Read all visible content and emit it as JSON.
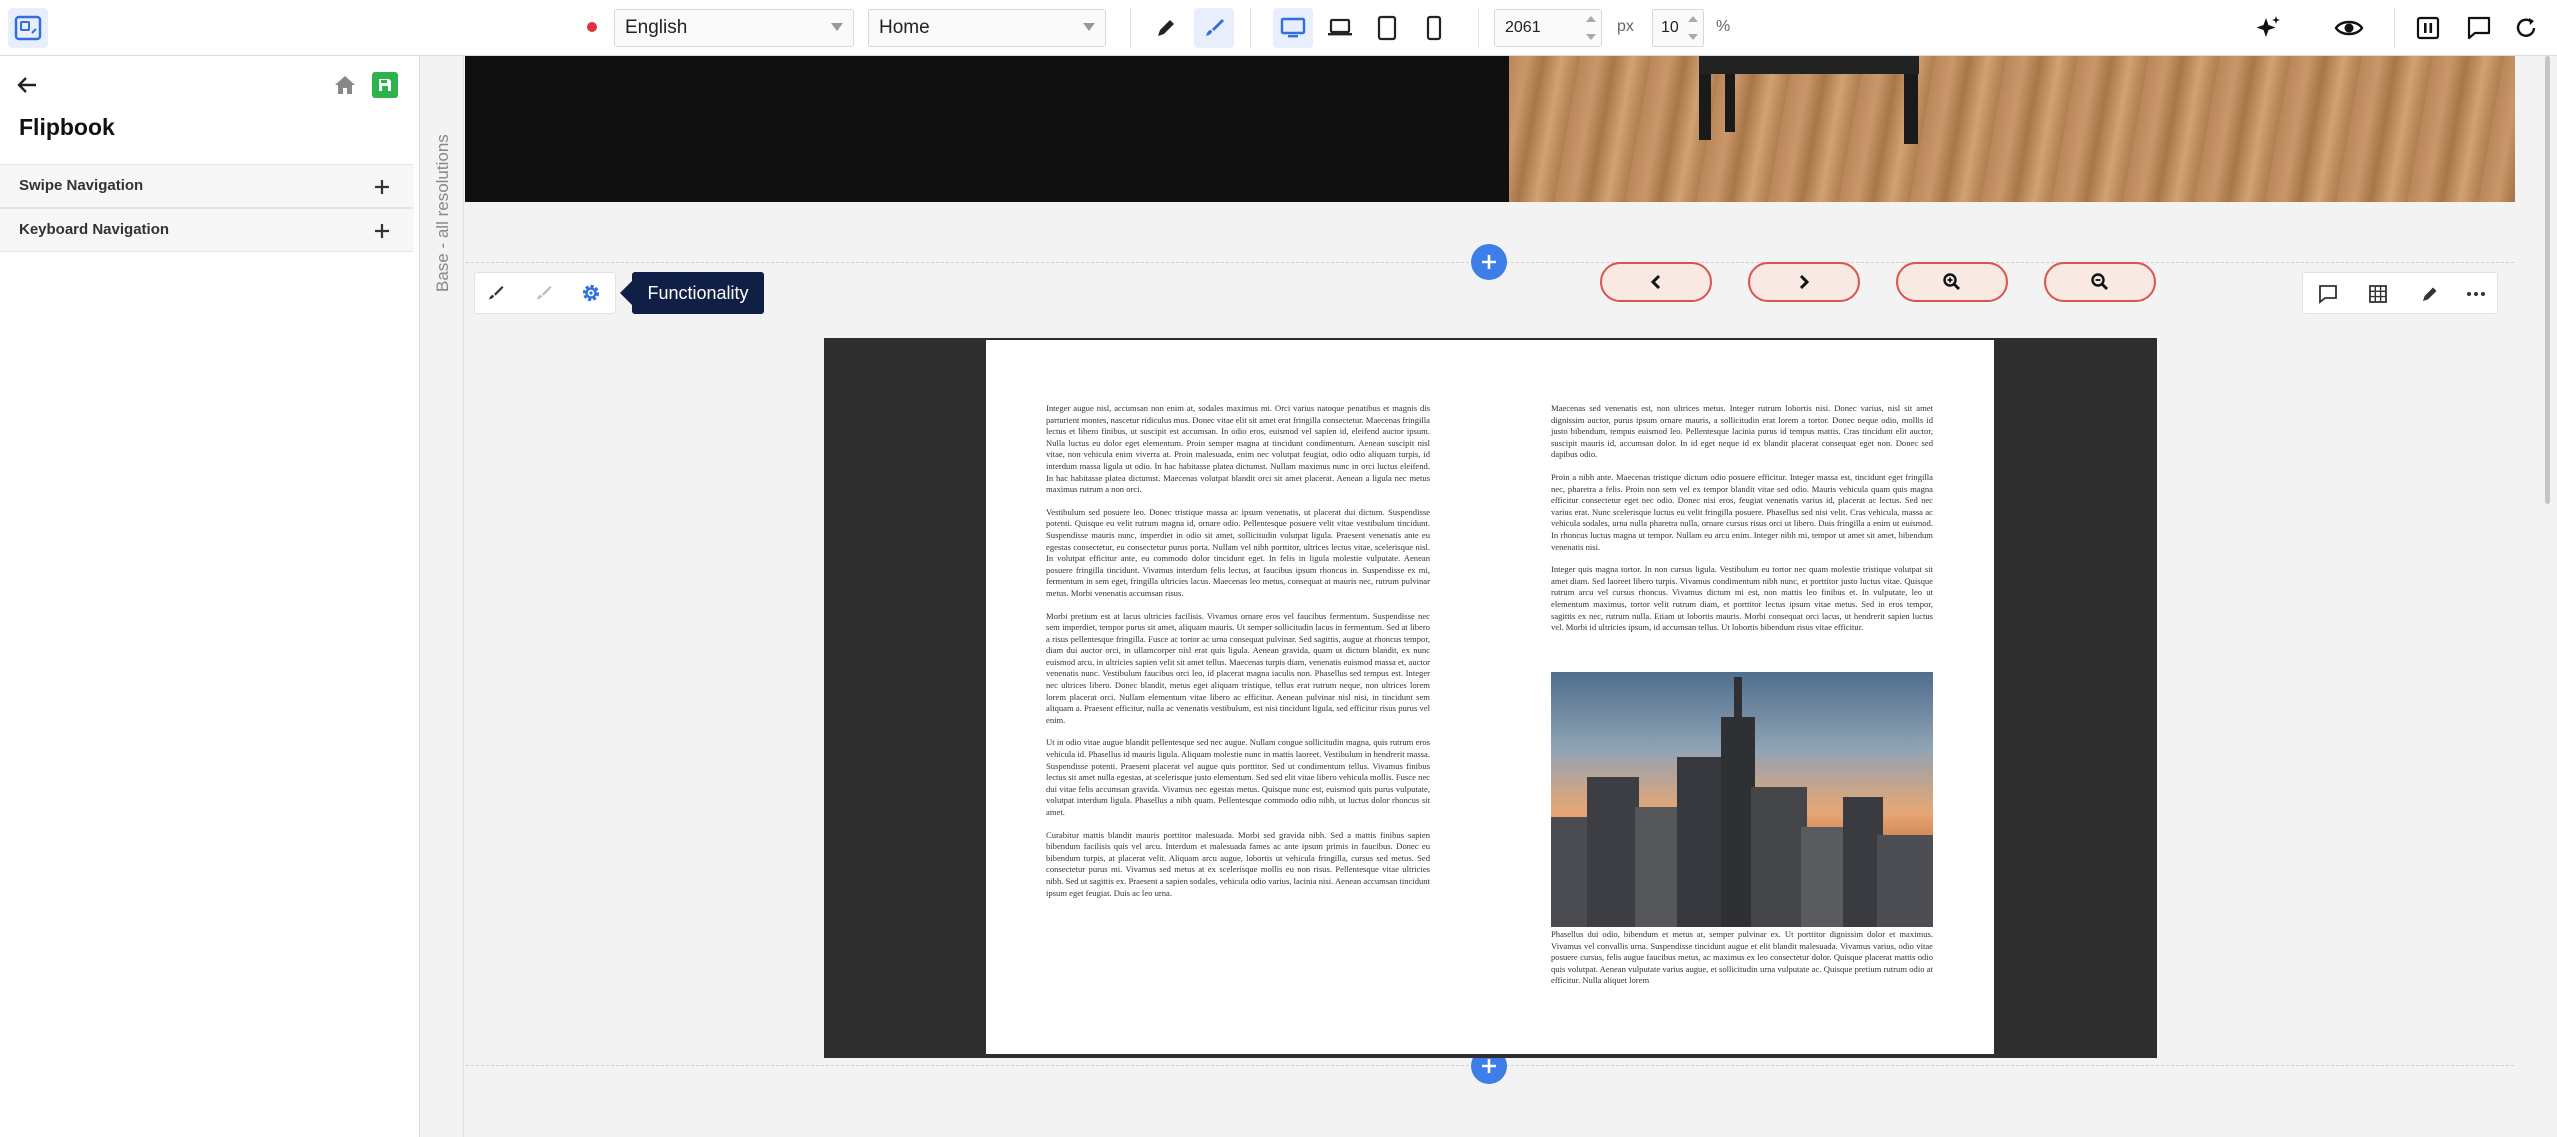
{
  "toolbar": {
    "language": {
      "selected": "English"
    },
    "page": {
      "selected": "Home"
    },
    "width_value": "2061",
    "width_unit": "px",
    "zoom_value": "10",
    "zoom_unit": "%"
  },
  "left_panel": {
    "title": "Flipbook",
    "accordions": [
      {
        "label": "Swipe Navigation"
      },
      {
        "label": "Keyboard Navigation"
      }
    ]
  },
  "vertical_label": "Base - all resolutions",
  "tooltip": "Functionality",
  "colors": {
    "accent": "#3d7ee8",
    "save_green": "#2db34a",
    "tooltip_bg": "#0f1f46",
    "pill_border": "#d9534f",
    "record_dot": "#e0303a"
  },
  "flipbook": {
    "left_page": [
      "Integer augue nisl, accumsan non enim at, sodales maximus mi. Orci varius natoque penatibus et magnis dis parturient montes, nascetur ridiculus mus. Donec vitae elit sit amet erat fringilla consectetur. Maecenas fringilla lectus et libero finibus, ut suscipit est accumsan. In odio eros, euismod vel sapien id, eleifend auctor ipsum. Nulla luctus eu dolor eget elementum. Proin semper magna at tincidunt condimentum. Aenean suscipit nisl vitae, non vehicula enim viverra at. Proin malesuada, enim nec volutpat feugiat, odio odio aliquam turpis, id interdum massa ligula ut odio. In hac habitasse platea dictumst. Nullam maximus nunc in orci luctus eleifend. In hac habitasse platea dictumst. Maecenas volutpat blandit orci sit amet placerat. Aenean a ligula nec metus maximus rutrum a non orci.",
      "Vestibulum sed posuere leo. Donec tristique massa ac ipsum venenatis, ut placerat dui dictum. Suspendisse potenti. Quisque eu velit rutrum magna id, ornare odio. Pellentesque posuere velit vitae vestibulum tincidunt. Suspendisse mauris nunc, imperdiet in odio sit amet, sollicitudin volutpat ligula. Praesent venenatis ante eu egestas consectetur, eu consectetur purus porta. Nullam vel nibh porttitor, ultrices lectus vitae, scelerisque nisl. In volutpat efficitur ante, eu commodo dolor tincidunt eget. In felis in ligula molestie vulputate. Aenean posuere fringilla tincidunt. Vivamus interdum felis lectus, at faucibus ipsum rhoncus in. Suspendisse ex mi, fermentum in sem eget, fringilla ultricies lacus. Maecenas leo metus, consequat at mauris nec, rutrum pulvinar metus. Morbi venenatis accumsan risus.",
      "Morbi pretium est at lacus ultricies facilisis. Vivamus ornare eros vel faucibus fermentum. Suspendisse nec sem imperdiet, tempor purus sit amet, aliquam mauris. Ut semper sollicitudin lacus in fermentum. Sed at libero a risus pellentesque fringilla. Fusce ac tortor ac urna consequat pulvinar. Sed sagittis, augue at rhoncus tempor, diam dui auctor orci, in ullamcorper nisl erat quis ligula. Aenean gravida, quam ut dictum blandit, ex nunc euismod arcu, in ultricies sapien velit sit amet tellus. Maecenas turpis diam, venenatis euismod massa et, auctor venenatis nunc. Vestibulum faucibus orci leo, id placerat magna iaculis non. Phasellus sed tempus est. Integer nec ultrices libero. Donec blandit, metus eget aliquam tristique, tellus erat rutrum neque, non ultrices lorem lorem placerat orci. Nullam elementum vitae libero ac efficitur. Aenean pulvinar nisl nisi, in tincidunt sem aliquam a. Praesent efficitur, nulla ac venenatis vestibulum, est nisi tincidunt ligula, sed efficitur risus purus vel enim.",
      "Ut in odio vitae augue blandit pellentesque sed nec augue. Nullam congue sollicitudin magna, quis rutrum eros vehicula id. Phasellus id mauris ligula. Aliquam molestie nunc in mattis laoreet. Vestibulum in hendrerit massa. Suspendisse potenti. Praesent placerat vel augue quis porttitor. Sed ut condimentum tellus. Vivamus finibus lectus sit amet nulla egestas, at scelerisque justo elementum. Sed sed elit vitae libero vehicula mollis. Fusce nec dui vitae felis accumsan gravida. Vivamus nec egestas metus. Quisque nunc est, euismod quis purus vulputate, volutpat interdum ligula. Phasellus a nibh quam. Pellentesque commodo odio nibh, ut luctus dolor rhoncus sit amet.",
      "Curabitur mattis blandit mauris porttitor malesuada. Morbi sed gravida nibh. Sed a mattis finibus sapien bibendum facilisis quis vel arcu. Interdum et malesuada fames ac ante ipsum primis in faucibus. Donec eu bibendum turpis, at placerat velit. Aliquam arcu augue, lobortis ut vehicula fringilla, cursus sed metus. Sed consectetur purus mi. Vivamus sed metus at ex scelerisque mollis eu non risus. Pellentesque vitae ultricies nibh. Sed ut sagittis ex. Praesent a sapien sodales, vehicula odio varius, lacinia nisi. Aenean accumsan tincidunt ipsum eget feugiat. Duis ac leo urna."
    ],
    "right_page": [
      "Maecenas sed venenatis est, non ultrices metus. Integer rutrum lobortis nisi. Donec varius, nisl sit amet dignissim auctor, purus ipsum ornare mauris, a sollicitudin erat lorem a tortor. Donec neque odio, mollis id justo bibendum, tempus euismod leo. Pellentesque lacinia purus id tempus mattis. Cras tincidunt elit auctor, suscipit mauris id, accumsan dolor. In id eget neque id ex blandit placerat consequat eget non. Donec sed dapibus odio.",
      "Proin a nibh ante. Maecenas tristique dictum odio posuere efficitur. Integer massa est, tincidunt eget fringilla nec, pharetra a felis. Proin non sem vel ex tempor blandit vitae sed odio. Mauris vehicula quam quis magna efficitur consectetur eget nec odio. Donec nisi eros, feugiat venenatis varius id, placerat ac lectus. Sed nec varius erat. Nunc scelerisque luctus eu velit fringilla posuere. Phasellus sed nisi velit. Cras vehicula, massa ac vehicula sodales, urna nulla pharetra nulla, ornare cursus risus orci ut libero. Duis fringilla a enim ut euismod. In rhoncus luctus magna ut tempor. Nullam eu arcu enim. Integer nibh mi, tempor ut amet sit amet, bibendum venenatis nisi.",
      "Integer quis magna tortor. In non cursus ligula. Vestibulum eu tortor nec quam molestie tristique volutpat sit amet diam. Sed laoreet libero turpis. Vivamus condimentum nibh nunc, et porttitor justo luctus vitae. Quisque rutrum arcu vel cursus rhoncus. Vivamus dictum mi est, non mattis leo finibus et. In vulputate, leo ut elementum maximus, tortor velit rutrum diam, et porttitor lectus ipsum vitae metus. Sed in eros tempor, sagittis ex nec, rutrum nulla. Etiam ut lobortis mauris. Morbi consequat orci lacus, ut hendrerit sapien luctus vel. Morbi id ultricies ipsum, id accumsan tellus. Ut lobortis bibendum risus vitae efficitur."
    ],
    "caption": "Phasellus dui odio, bibendum et metus at, semper pulvinar ex. Ut porttitor dignissim dolor et maximus. Vivamus vel convallis urna. Suspendisse tincidunt augue et elit blandit malesuada. Vivamus varius, odio vitae posuere cursus, felis augue faucibus metus, ac maximus ex leo consectetur dolor. Quisque placerat mattis odio quis volutpat. Aenean vulputate varius augue, et sollicitudin urna vulputate ac. Quisque pretium rutrum odio at efficitur. Nulla aliquet lorem"
  },
  "icons": {
    "app_logo": "layout-frame-icon",
    "back": "arrow-left-icon",
    "home": "home-icon",
    "save": "save-icon",
    "pencil": "pencil-icon",
    "brush": "brush-icon",
    "desktop": "desktop-icon",
    "laptop": "laptop-icon",
    "tablet": "tablet-icon",
    "mobile": "mobile-icon",
    "sparkle": "ai-sparkle-icon",
    "eye": "eye-icon",
    "pause": "pause-frame-icon",
    "comment": "comment-icon",
    "refresh": "refresh-icon",
    "gear": "gear-icon",
    "grid": "grid-icon",
    "more": "more-icon",
    "prev": "chevron-left-icon",
    "next": "chevron-right-icon",
    "zoom_in": "zoom-in-icon",
    "zoom_out": "zoom-out-icon"
  }
}
